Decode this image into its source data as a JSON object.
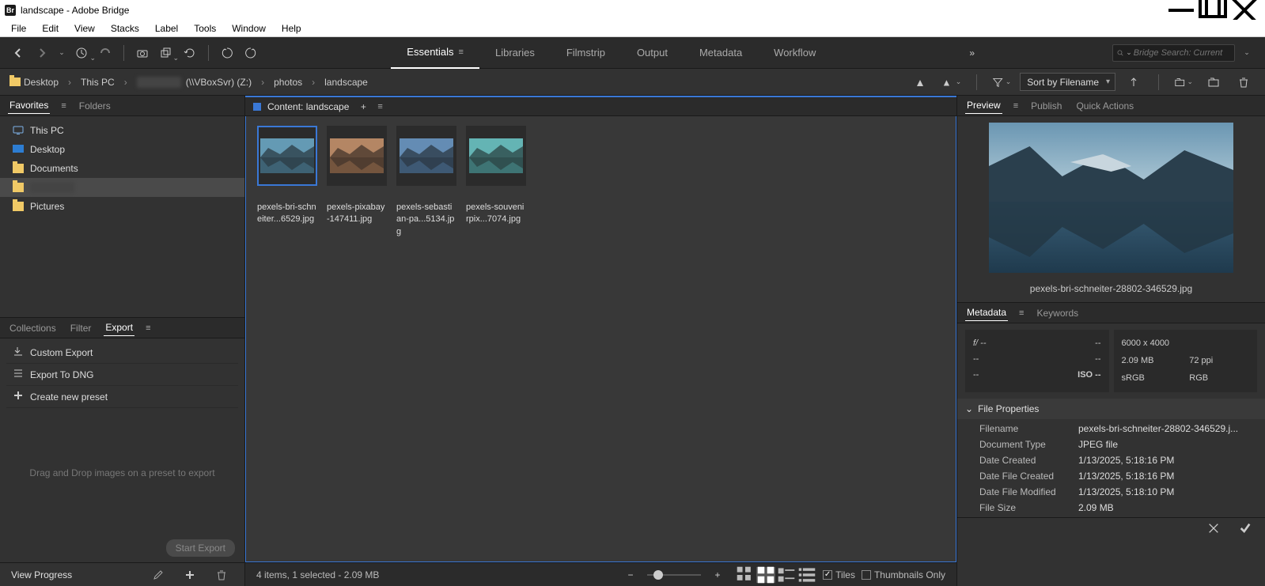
{
  "window": {
    "title": "landscape - Adobe Bridge",
    "app_badge": "Br"
  },
  "menu": [
    "File",
    "Edit",
    "View",
    "Stacks",
    "Label",
    "Tools",
    "Window",
    "Help"
  ],
  "workspaces": {
    "items": [
      "Essentials",
      "Libraries",
      "Filmstrip",
      "Output",
      "Metadata",
      "Workflow"
    ],
    "active": 0
  },
  "search": {
    "placeholder": "Bridge Search: Current"
  },
  "breadcrumb": [
    {
      "name": "Desktop",
      "icon": "folder"
    },
    {
      "name": "This PC",
      "icon": ""
    },
    {
      "name": "(\\\\VBoxSvr) (Z:)",
      "icon": "",
      "blur": true
    },
    {
      "name": "photos",
      "icon": ""
    },
    {
      "name": "landscape",
      "icon": ""
    }
  ],
  "sort": {
    "label": "Sort by Filename"
  },
  "leftTabs": {
    "items": [
      "Favorites",
      "Folders"
    ],
    "active": 0
  },
  "favorites": [
    {
      "name": "This PC",
      "icon": "pc"
    },
    {
      "name": "Desktop",
      "icon": "desktop"
    },
    {
      "name": "Documents",
      "icon": "folder"
    },
    {
      "name": "",
      "icon": "folder",
      "blur": true
    },
    {
      "name": "Pictures",
      "icon": "folder"
    }
  ],
  "lowerTabs": {
    "items": [
      "Collections",
      "Filter",
      "Export"
    ],
    "active": 2
  },
  "export": {
    "items": [
      {
        "icon": "export-icon",
        "label": "Custom Export"
      },
      {
        "icon": "list-icon",
        "label": "Export To DNG"
      },
      {
        "icon": "plus-icon",
        "label": "Create new preset"
      }
    ],
    "hint": "Drag and Drop images on a preset to export",
    "start": "Start Export",
    "progress": "View Progress"
  },
  "content": {
    "title": "Content: landscape",
    "thumbs": [
      {
        "name": "pexels-bri-schneiter...6529.jpg",
        "selected": true,
        "hue": 200
      },
      {
        "name": "pexels-pixabay-147411.jpg",
        "selected": false,
        "hue": 25
      },
      {
        "name": "pexels-sebastian-pa...5134.jpg",
        "selected": false,
        "hue": 210
      },
      {
        "name": "pexels-souvenirpix...7074.jpg",
        "selected": false,
        "hue": 180
      }
    ],
    "status": "4 items, 1 selected - 2.09 MB",
    "view": {
      "tiles": "Tiles",
      "thumbsOnly": "Thumbnails Only"
    }
  },
  "previewTabs": {
    "items": [
      "Preview",
      "Publish",
      "Quick Actions"
    ],
    "active": 0
  },
  "preview": {
    "caption": "pexels-bri-schneiter-28802-346529.jpg"
  },
  "metaTabs": {
    "items": [
      "Metadata",
      "Keywords"
    ],
    "active": 0
  },
  "meta": {
    "exif": {
      "f": "f/ --",
      "shutter": "--",
      "ev": "--",
      "flash": "--",
      "exp": "--",
      "iso": "ISO --"
    },
    "sizecard": {
      "dim": "6000 x 4000",
      "size": "2.09 MB",
      "ppi": "72 ppi",
      "cs": "sRGB",
      "mode": "RGB"
    },
    "section": "File Properties",
    "rows": [
      {
        "k": "Filename",
        "v": "pexels-bri-schneiter-28802-346529.j..."
      },
      {
        "k": "Document Type",
        "v": "JPEG file"
      },
      {
        "k": "Date Created",
        "v": "1/13/2025, 5:18:16 PM"
      },
      {
        "k": "Date File Created",
        "v": "1/13/2025, 5:18:16 PM"
      },
      {
        "k": "Date File Modified",
        "v": "1/13/2025, 5:18:10 PM"
      },
      {
        "k": "File Size",
        "v": "2.09 MB"
      }
    ]
  }
}
